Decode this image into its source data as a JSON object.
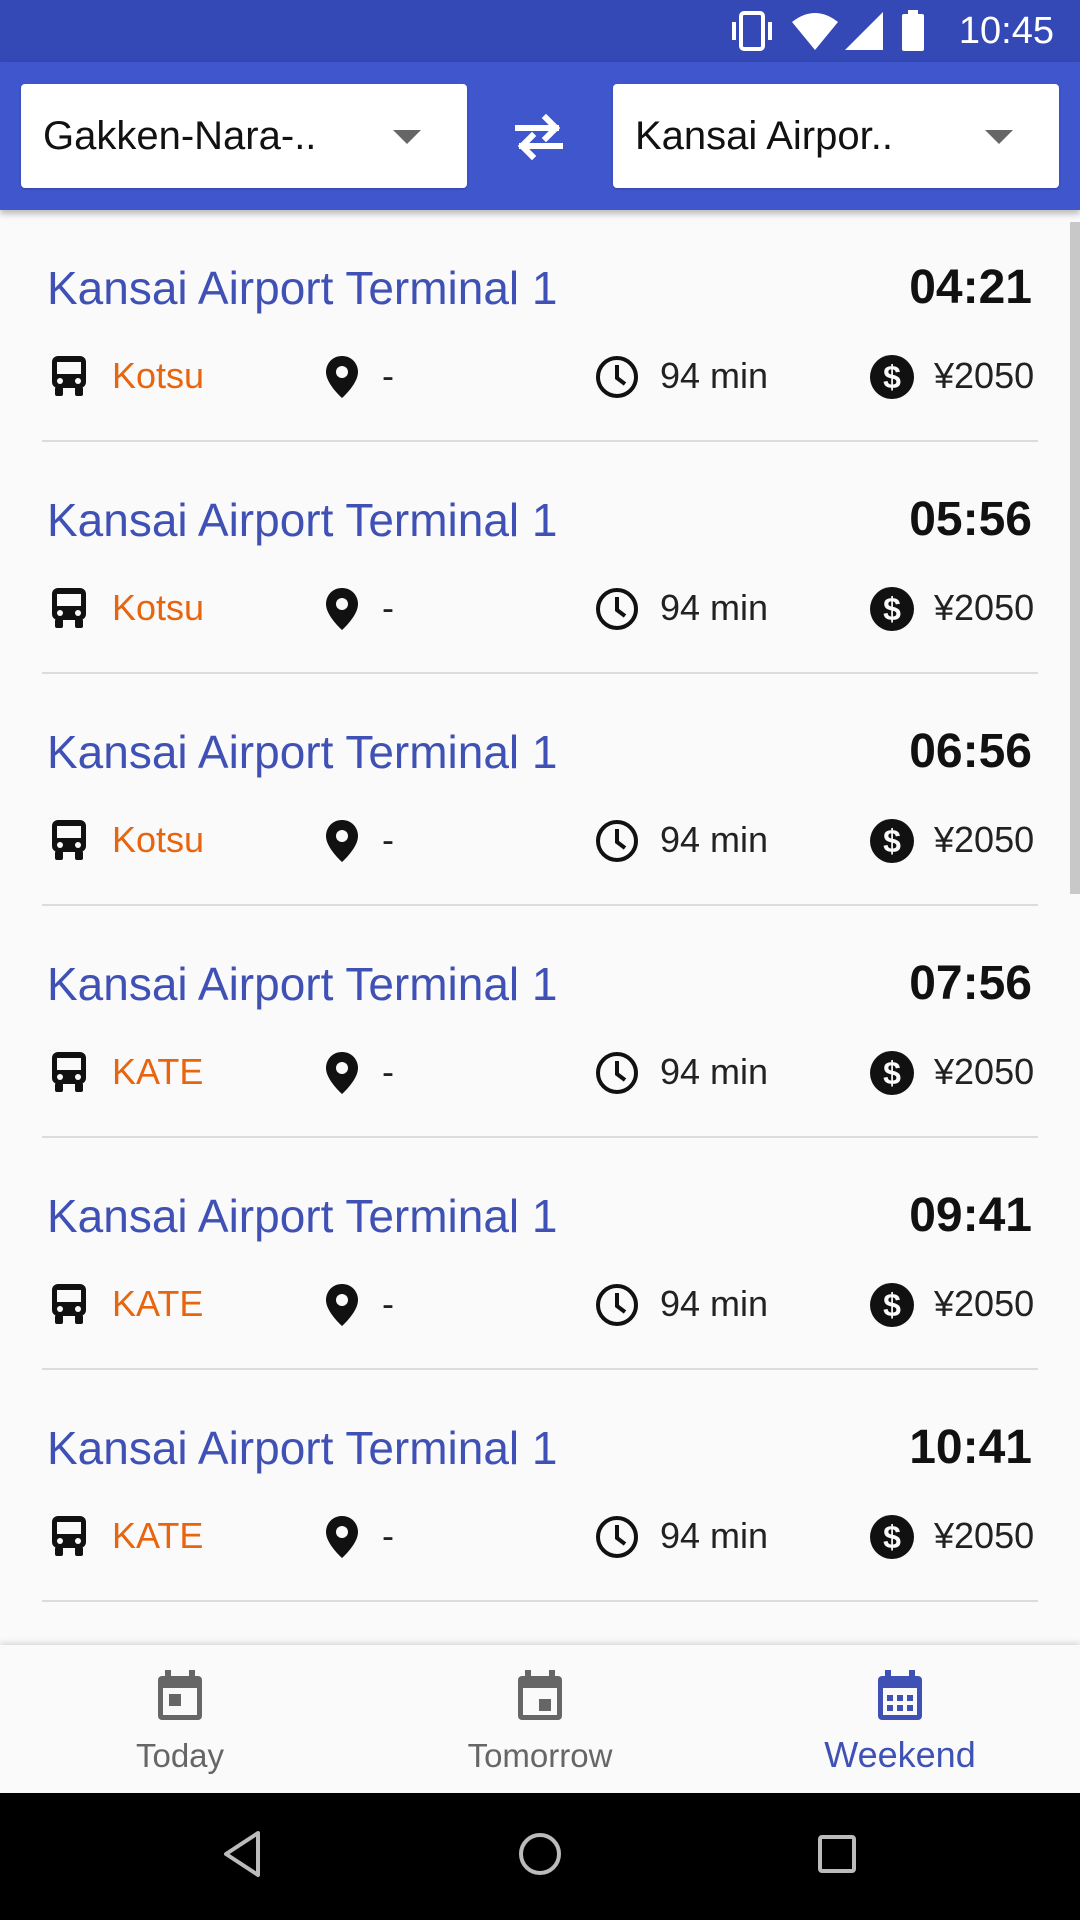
{
  "status_bar": {
    "time": "10:45",
    "icons": [
      "vibrate-icon",
      "wifi-icon",
      "signal-icon",
      "battery-icon"
    ]
  },
  "header": {
    "from_select": {
      "value": "Gakken-Nara-.."
    },
    "to_select": {
      "value": "Kansai Airpor.."
    },
    "swap_icon": "swap-horizontal-icon"
  },
  "routes": [
    {
      "destination": "Kansai Airport Terminal 1",
      "departure": "04:21",
      "operator": "Kotsu",
      "stop": "-",
      "duration": "94 min",
      "fare": "¥2050"
    },
    {
      "destination": "Kansai Airport Terminal 1",
      "departure": "05:56",
      "operator": "Kotsu",
      "stop": "-",
      "duration": "94 min",
      "fare": "¥2050"
    },
    {
      "destination": "Kansai Airport Terminal 1",
      "departure": "06:56",
      "operator": "Kotsu",
      "stop": "-",
      "duration": "94 min",
      "fare": "¥2050"
    },
    {
      "destination": "Kansai Airport Terminal 1",
      "departure": "07:56",
      "operator": "KATE",
      "stop": "-",
      "duration": "94 min",
      "fare": "¥2050"
    },
    {
      "destination": "Kansai Airport Terminal 1",
      "departure": "09:41",
      "operator": "KATE",
      "stop": "-",
      "duration": "94 min",
      "fare": "¥2050"
    },
    {
      "destination": "Kansai Airport Terminal 1",
      "departure": "10:41",
      "operator": "KATE",
      "stop": "-",
      "duration": "94 min",
      "fare": "¥2050"
    }
  ],
  "bottom_nav": {
    "items": [
      {
        "label": "Today",
        "icon": "calendar-today-icon",
        "active": false
      },
      {
        "label": "Tomorrow",
        "icon": "calendar-tomorrow-icon",
        "active": false
      },
      {
        "label": "Weekend",
        "icon": "calendar-weekend-icon",
        "active": true
      }
    ]
  },
  "colors": {
    "status_bar": "#3449b5",
    "header": "#3f56cc",
    "accent": "#3f51b5",
    "operator": "#e8650f"
  }
}
